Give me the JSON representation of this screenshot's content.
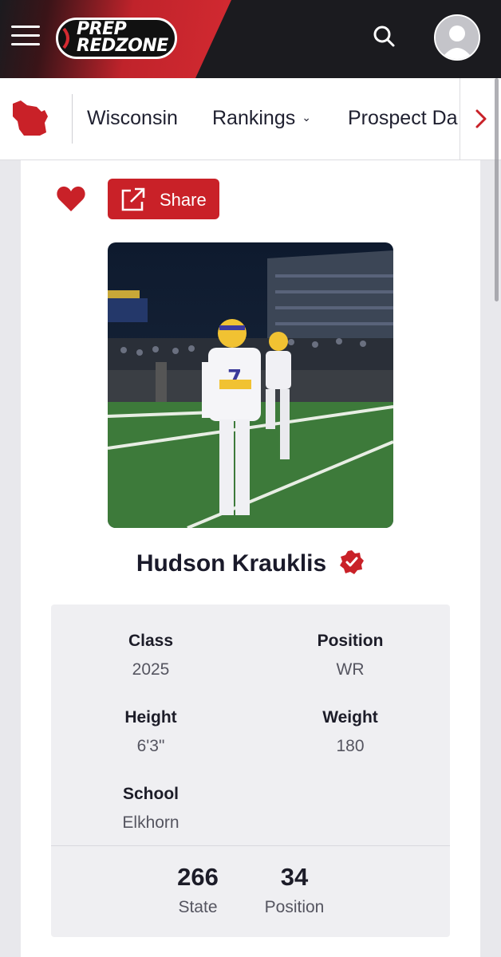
{
  "header": {
    "logo_line1": "PREP",
    "logo_line2": "REDZONE"
  },
  "nav": {
    "items": [
      {
        "label": "Wisconsin"
      },
      {
        "label": "Rankings"
      },
      {
        "label": "Prospect Da"
      }
    ]
  },
  "actions": {
    "share_label": "Share"
  },
  "player": {
    "name": "Hudson Krauklis",
    "stats": [
      {
        "label": "Class",
        "value": "2025"
      },
      {
        "label": "Position",
        "value": "WR"
      },
      {
        "label": "Height",
        "value": "6'3\""
      },
      {
        "label": "Weight",
        "value": "180"
      },
      {
        "label": "School",
        "value": "Elkhorn"
      }
    ],
    "rankings": [
      {
        "value": "266",
        "label": "State"
      },
      {
        "value": "34",
        "label": "Position"
      }
    ]
  },
  "colors": {
    "brand_red": "#c92128",
    "header_dark": "#1b1b1f"
  },
  "icons": [
    "menu-icon",
    "search-icon",
    "user-avatar-icon",
    "wisconsin-state-icon",
    "chevron-down-icon",
    "chevron-right-icon",
    "heart-icon",
    "share-icon",
    "verified-icon"
  ]
}
